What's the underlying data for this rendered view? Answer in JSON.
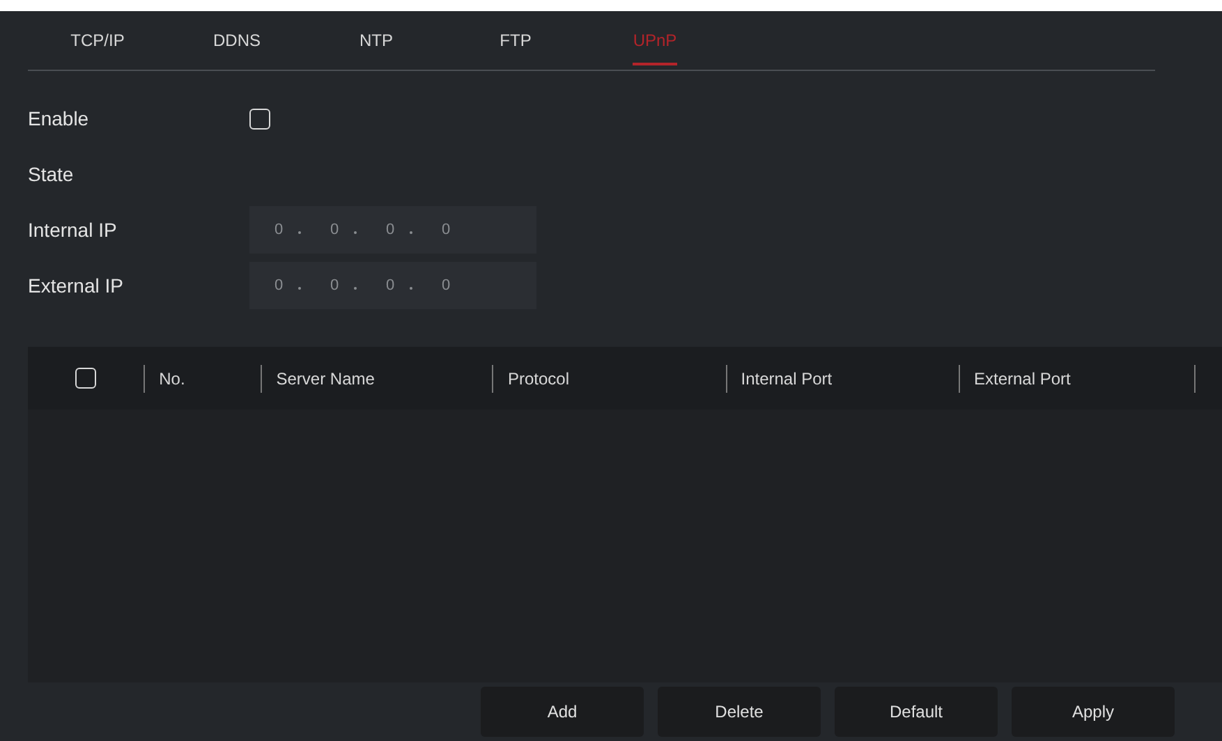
{
  "tabs": [
    {
      "label": "TCP/IP",
      "selected": false
    },
    {
      "label": "DDNS",
      "selected": false
    },
    {
      "label": "NTP",
      "selected": false
    },
    {
      "label": "FTP",
      "selected": false
    },
    {
      "label": "UPnP",
      "selected": true
    }
  ],
  "form": {
    "enable": {
      "label": "Enable",
      "checked": false
    },
    "state": {
      "label": "State"
    },
    "internal_ip": {
      "label": "Internal IP",
      "octets": [
        "0",
        "0",
        "0",
        "0"
      ]
    },
    "external_ip": {
      "label": "External IP",
      "octets": [
        "0",
        "0",
        "0",
        "0"
      ]
    }
  },
  "table": {
    "select_all_checked": false,
    "columns": [
      "No.",
      "Server Name",
      "Protocol",
      "Internal Port",
      "External Port"
    ]
  },
  "buttons": [
    "Add",
    "Delete",
    "Default",
    "Apply"
  ]
}
